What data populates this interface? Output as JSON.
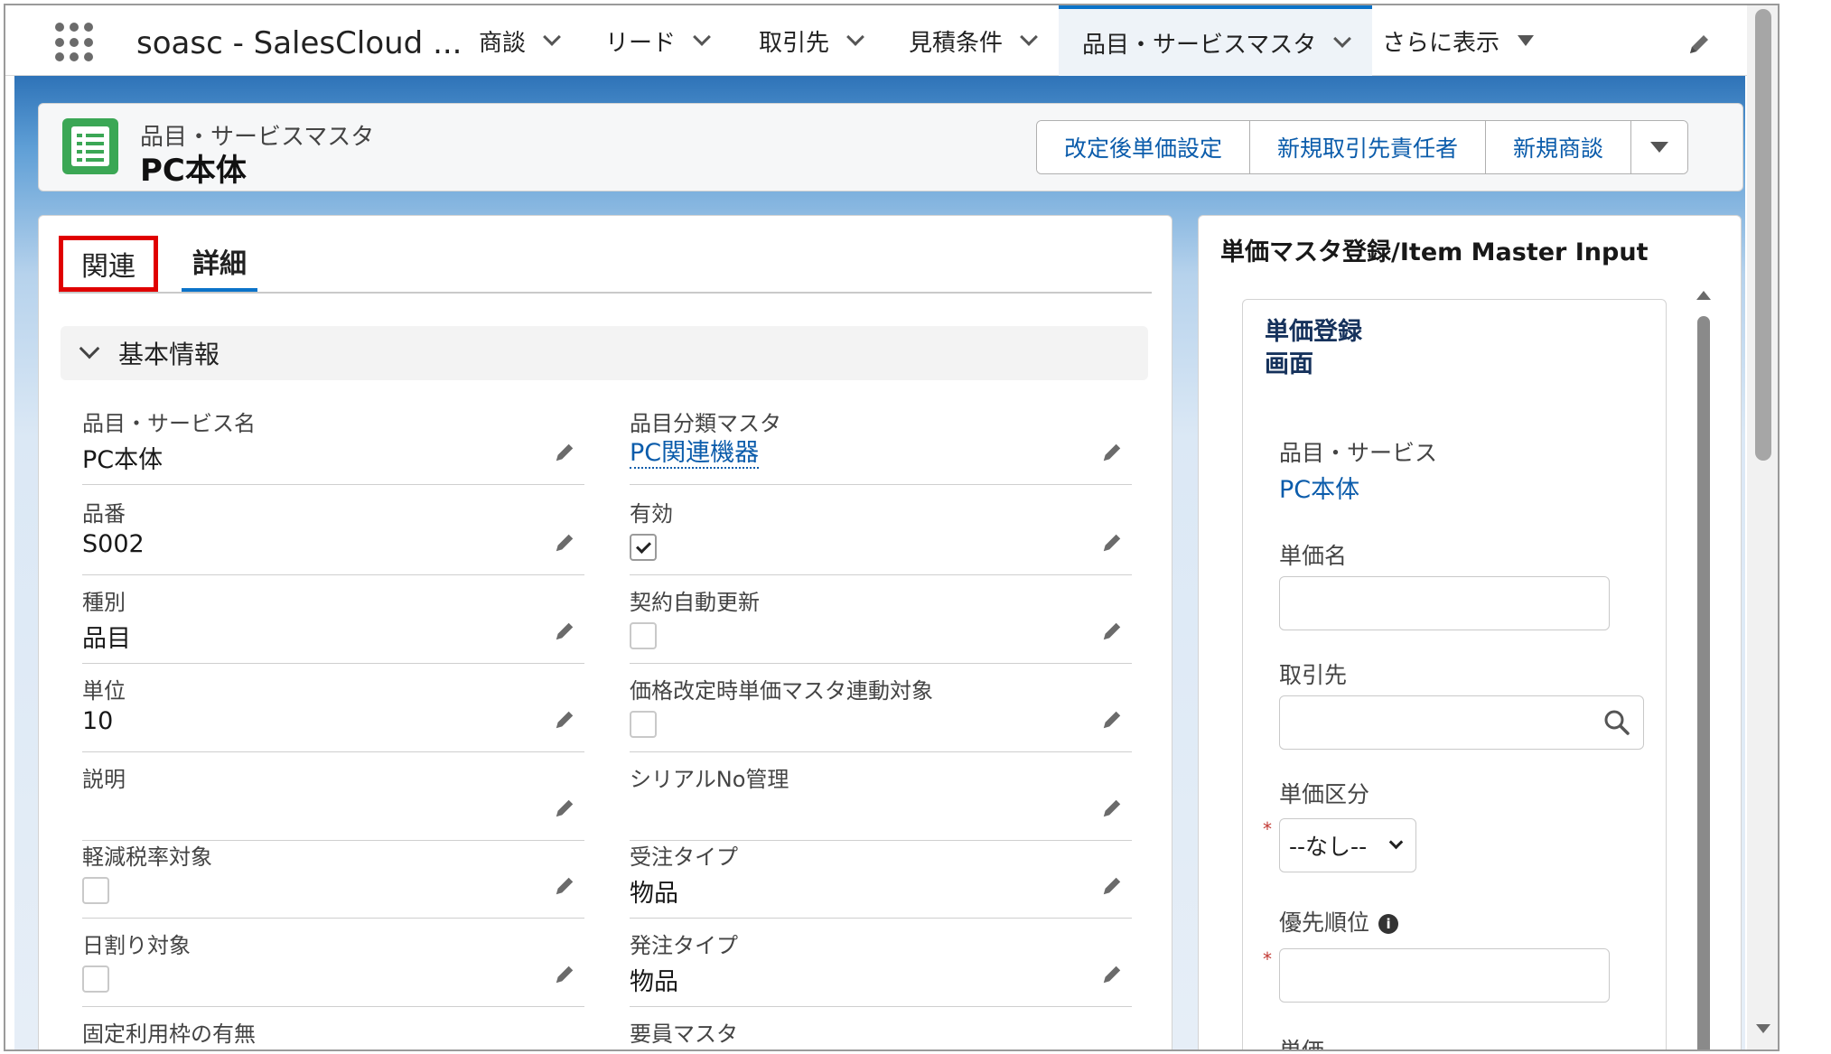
{
  "nav": {
    "app_name": "soasc - SalesCloud ...",
    "items": [
      {
        "label": "商談"
      },
      {
        "label": "リード"
      },
      {
        "label": "取引先"
      },
      {
        "label": "見積条件"
      },
      {
        "label": "品目・サービスマスタ"
      },
      {
        "label": "さらに表示"
      }
    ]
  },
  "header": {
    "object_label": "品目・サービスマスタ",
    "record_title": "PC本体",
    "actions": [
      {
        "label": "改定後単価設定"
      },
      {
        "label": "新規取引先責任者"
      },
      {
        "label": "新規商談"
      }
    ]
  },
  "tabs": [
    {
      "label": "関連"
    },
    {
      "label": "詳細"
    }
  ],
  "section": {
    "title": "基本情報"
  },
  "fields_left": [
    {
      "label": "品目・サービス名",
      "value": "PC本体"
    },
    {
      "label": "品番",
      "value": "S002"
    },
    {
      "label": "種別",
      "value": "品目"
    },
    {
      "label": "単位",
      "value": "10"
    },
    {
      "label": "説明",
      "value": ""
    },
    {
      "label": "軽減税率対象",
      "checked": false
    },
    {
      "label": "日割り対象",
      "checked": false
    },
    {
      "label": "固定利用枠の有無"
    }
  ],
  "fields_right": [
    {
      "label": "品目分類マスタ",
      "value": "PC関連機器"
    },
    {
      "label": "有効",
      "checked": true
    },
    {
      "label": "契約自動更新",
      "checked": false
    },
    {
      "label": "価格改定時単価マスタ連動対象",
      "checked": false
    },
    {
      "label": "シリアルNo管理",
      "value": ""
    },
    {
      "label": "受注タイプ",
      "value": "物品"
    },
    {
      "label": "発注タイプ",
      "value": "物品"
    },
    {
      "label": "要員マスタ"
    }
  ],
  "right_panel": {
    "title": "単価マスタ登録/Item Master Input",
    "inner_title": "単価登録\n画面",
    "item_label": "品目・サービス",
    "item_value": "PC本体",
    "price_name_label": "単価名",
    "account_label": "取引先",
    "price_type_label": "単価区分",
    "price_type_value": "--なし--",
    "priority_label": "優先順位",
    "unit_price_label": "単価",
    "required_mark": "*",
    "info_glyph": "i"
  },
  "icons": {
    "edit": "pencil-icon",
    "search": "search-icon",
    "launcher": "app-launcher-icon"
  },
  "colors": {
    "brand_blue": "#0b73c9",
    "link": "#0b5cab",
    "record_icon": "#3ba755",
    "highlight_box": "#e00000"
  }
}
